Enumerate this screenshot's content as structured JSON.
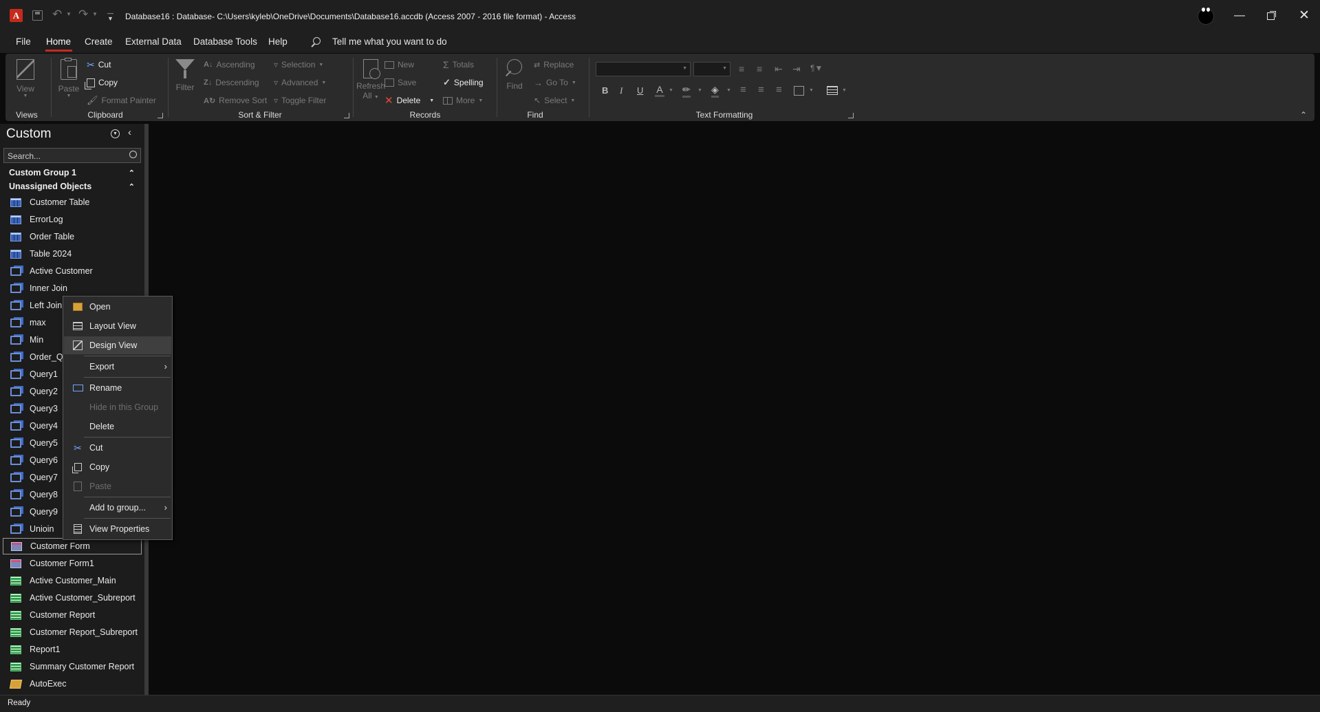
{
  "title_bar": {
    "title": "Database16 : Database- C:\\Users\\kyleb\\OneDrive\\Documents\\Database16.accdb (Access 2007 - 2016 file format)  -  Access",
    "app_icon": "access-logo",
    "qat": [
      "save-icon",
      "undo-icon",
      "redo-icon",
      "customize-qat-icon"
    ],
    "window_controls": [
      "minimize-icon",
      "restore-icon",
      "close-icon"
    ]
  },
  "tabs": {
    "items": [
      "File",
      "Home",
      "Create",
      "External Data",
      "Database Tools",
      "Help"
    ],
    "active": "Home",
    "tell_me": "Tell me what you want to do"
  },
  "ribbon": {
    "views": {
      "label": "Views",
      "view": "View"
    },
    "clipboard": {
      "label": "Clipboard",
      "paste": "Paste",
      "cut": "Cut",
      "copy": "Copy",
      "format_painter": "Format Painter"
    },
    "sort_filter": {
      "label": "Sort & Filter",
      "filter": "Filter",
      "ascending": "Ascending",
      "descending": "Descending",
      "remove_sort": "Remove Sort",
      "selection": "Selection",
      "advanced": "Advanced",
      "toggle_filter": "Toggle Filter"
    },
    "records": {
      "label": "Records",
      "refresh": "Refresh",
      "refresh_all": "All",
      "new": "New",
      "save": "Save",
      "delete": "Delete",
      "totals": "Totals",
      "spelling": "Spelling",
      "more": "More"
    },
    "find": {
      "label": "Find",
      "find": "Find",
      "replace": "Replace",
      "goto": "Go To",
      "select": "Select"
    },
    "text_formatting": {
      "label": "Text Formatting",
      "bold": "B",
      "italic": "I",
      "underline": "U",
      "font_color": "A"
    }
  },
  "nav": {
    "title": "Custom",
    "search_placeholder": "Search...",
    "groups": [
      "Custom Group 1",
      "Unassigned Objects"
    ],
    "items": [
      {
        "label": "Customer Table",
        "type": "table"
      },
      {
        "label": "ErrorLog",
        "type": "table"
      },
      {
        "label": "Order Table",
        "type": "table"
      },
      {
        "label": "Table 2024",
        "type": "table"
      },
      {
        "label": "Active Customer",
        "type": "query"
      },
      {
        "label": "Inner Join",
        "type": "query"
      },
      {
        "label": "Left Join",
        "type": "query"
      },
      {
        "label": "max",
        "type": "query"
      },
      {
        "label": "Min",
        "type": "query"
      },
      {
        "label": "Order_Qu",
        "type": "query"
      },
      {
        "label": "Query1",
        "type": "query"
      },
      {
        "label": "Query2",
        "type": "query"
      },
      {
        "label": "Query3",
        "type": "query"
      },
      {
        "label": "Query4",
        "type": "query"
      },
      {
        "label": "Query5",
        "type": "query"
      },
      {
        "label": "Query6",
        "type": "query"
      },
      {
        "label": "Query7",
        "type": "query"
      },
      {
        "label": "Query8",
        "type": "query"
      },
      {
        "label": "Query9",
        "type": "query"
      },
      {
        "label": "Unioin",
        "type": "query"
      },
      {
        "label": "Customer Form",
        "type": "form",
        "selected": true
      },
      {
        "label": "Customer Form1",
        "type": "form"
      },
      {
        "label": "Active Customer_Main",
        "type": "report"
      },
      {
        "label": "Active Customer_Subreport",
        "type": "report"
      },
      {
        "label": "Customer Report",
        "type": "report"
      },
      {
        "label": "Customer Report_Subreport",
        "type": "report"
      },
      {
        "label": "Report1",
        "type": "report"
      },
      {
        "label": "Summary Customer Report",
        "type": "report"
      },
      {
        "label": "AutoExec",
        "type": "macro"
      }
    ]
  },
  "context_menu": {
    "open": "Open",
    "layout_view": "Layout View",
    "design_view": "Design View",
    "export": "Export",
    "rename": "Rename",
    "hide_in_group": "Hide in this Group",
    "delete": "Delete",
    "cut": "Cut",
    "copy": "Copy",
    "paste": "Paste",
    "add_to_group": "Add to group...",
    "view_properties": "View Properties"
  },
  "status": {
    "text": "Ready"
  },
  "colors": {
    "accent_red": "#c42b1c",
    "selection_border": "#9a9a9a",
    "ribbon_bg": "#2b2b2b"
  }
}
